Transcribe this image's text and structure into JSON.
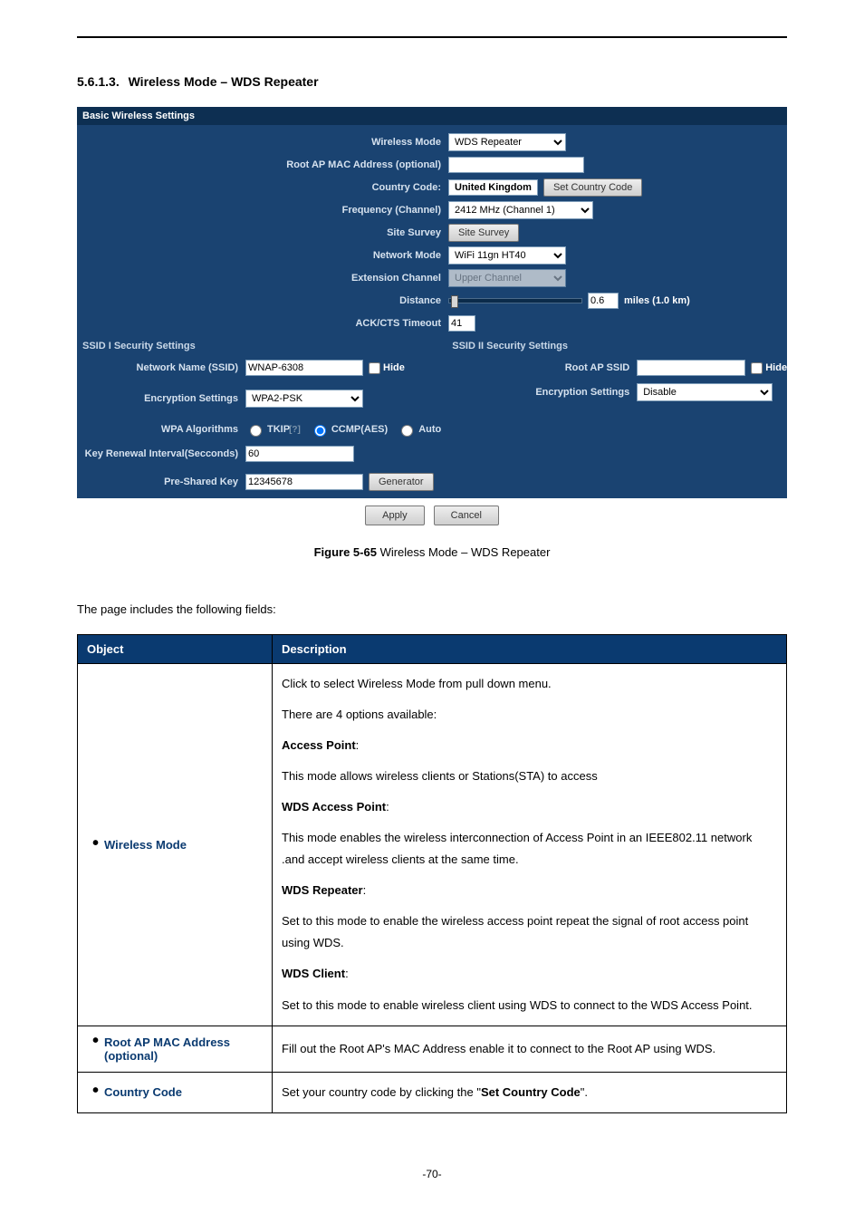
{
  "heading": {
    "num": "5.6.1.3.",
    "title": "Wireless Mode – WDS Repeater"
  },
  "panel": {
    "header_basic": "Basic Wireless Settings",
    "labels": {
      "wireless_mode": "Wireless Mode",
      "root_mac": "Root AP MAC Address (optional)",
      "country_code": "Country Code:",
      "freq": "Frequency (Channel)",
      "site_survey": "Site Survey",
      "network_mode": "Network Mode",
      "ext_channel": "Extension Channel",
      "distance": "Distance",
      "ack": "ACK/CTS Timeout"
    },
    "values": {
      "wireless_mode": "WDS Repeater",
      "root_mac": "",
      "country": "United Kingdom",
      "set_country_btn": "Set Country Code",
      "freq": "2412 MHz (Channel 1)",
      "site_survey_btn": "Site Survey",
      "network_mode": "WiFi 11gn HT40",
      "ext_channel": "Upper Channel",
      "distance_val": "0.6",
      "distance_unit": "miles (1.0 km)",
      "ack": "41"
    },
    "ssid1_header": "SSID I Security Settings",
    "ssid2_header": "SSID II Security Settings",
    "ssid1": {
      "name_label": "Network Name (SSID)",
      "name_val": "WNAP-6308",
      "hide": "Hide",
      "enc_label": "Encryption Settings",
      "enc_val": "WPA2-PSK",
      "wpa_label": "WPA Algorithms",
      "alg_tkip": "TKIP",
      "alg_tkip_sup": "[?]",
      "alg_ccmp": "CCMP(AES)",
      "alg_auto": "Auto",
      "key_interval_label": "Key Renewal Interval(Secconds)",
      "key_interval_val": "60",
      "psk_label": "Pre-Shared Key",
      "psk_val": "12345678",
      "gen_btn": "Generator"
    },
    "ssid2": {
      "root_label": "Root AP SSID",
      "root_val": "",
      "hide": "Hide",
      "enc_label": "Encryption Settings",
      "enc_val": "Disable"
    },
    "apply": "Apply",
    "cancel": "Cancel"
  },
  "figcap": {
    "bold": "Figure 5-65",
    "rest": " Wireless Mode – WDS Repeater"
  },
  "lead": "The page includes the following fields:",
  "table": {
    "head_obj": "Object",
    "head_desc": "Description",
    "rows": [
      {
        "obj": "Wireless Mode",
        "desc": {
          "p": [
            "Click to select Wireless Mode from pull down menu.",
            "There are 4 options available:",
            "<b>Access Point</b>:",
            "This mode allows wireless clients or Stations(STA) to access",
            "<b>WDS Access Point</b>:",
            "This mode enables the wireless interconnection of Access Point in an IEEE802.11 network .and accept wireless clients at the same time.",
            "<b>WDS Repeater</b>:",
            "Set to this mode to enable the wireless access point repeat the signal of root access point using WDS.",
            "<b>WDS Client</b>:",
            "Set to this mode to enable wireless client using WDS to connect to the WDS Access Point."
          ]
        }
      },
      {
        "obj": "Root AP MAC Address (optional)",
        "desc": {
          "p": [
            "Fill out the Root AP's MAC Address enable it to connect to the Root AP using WDS."
          ]
        }
      },
      {
        "obj": "Country Code",
        "desc": {
          "p": [
            "Set your country code by clicking the \"<b>Set Country Code</b>\"."
          ]
        }
      }
    ]
  },
  "pagenum": "-70-"
}
